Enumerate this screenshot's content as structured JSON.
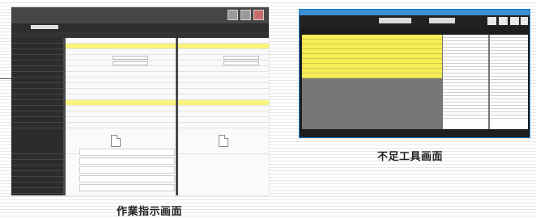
{
  "captions": {
    "work_instruction": "作業指示画面",
    "tool_shortage": "不足工具画面"
  }
}
